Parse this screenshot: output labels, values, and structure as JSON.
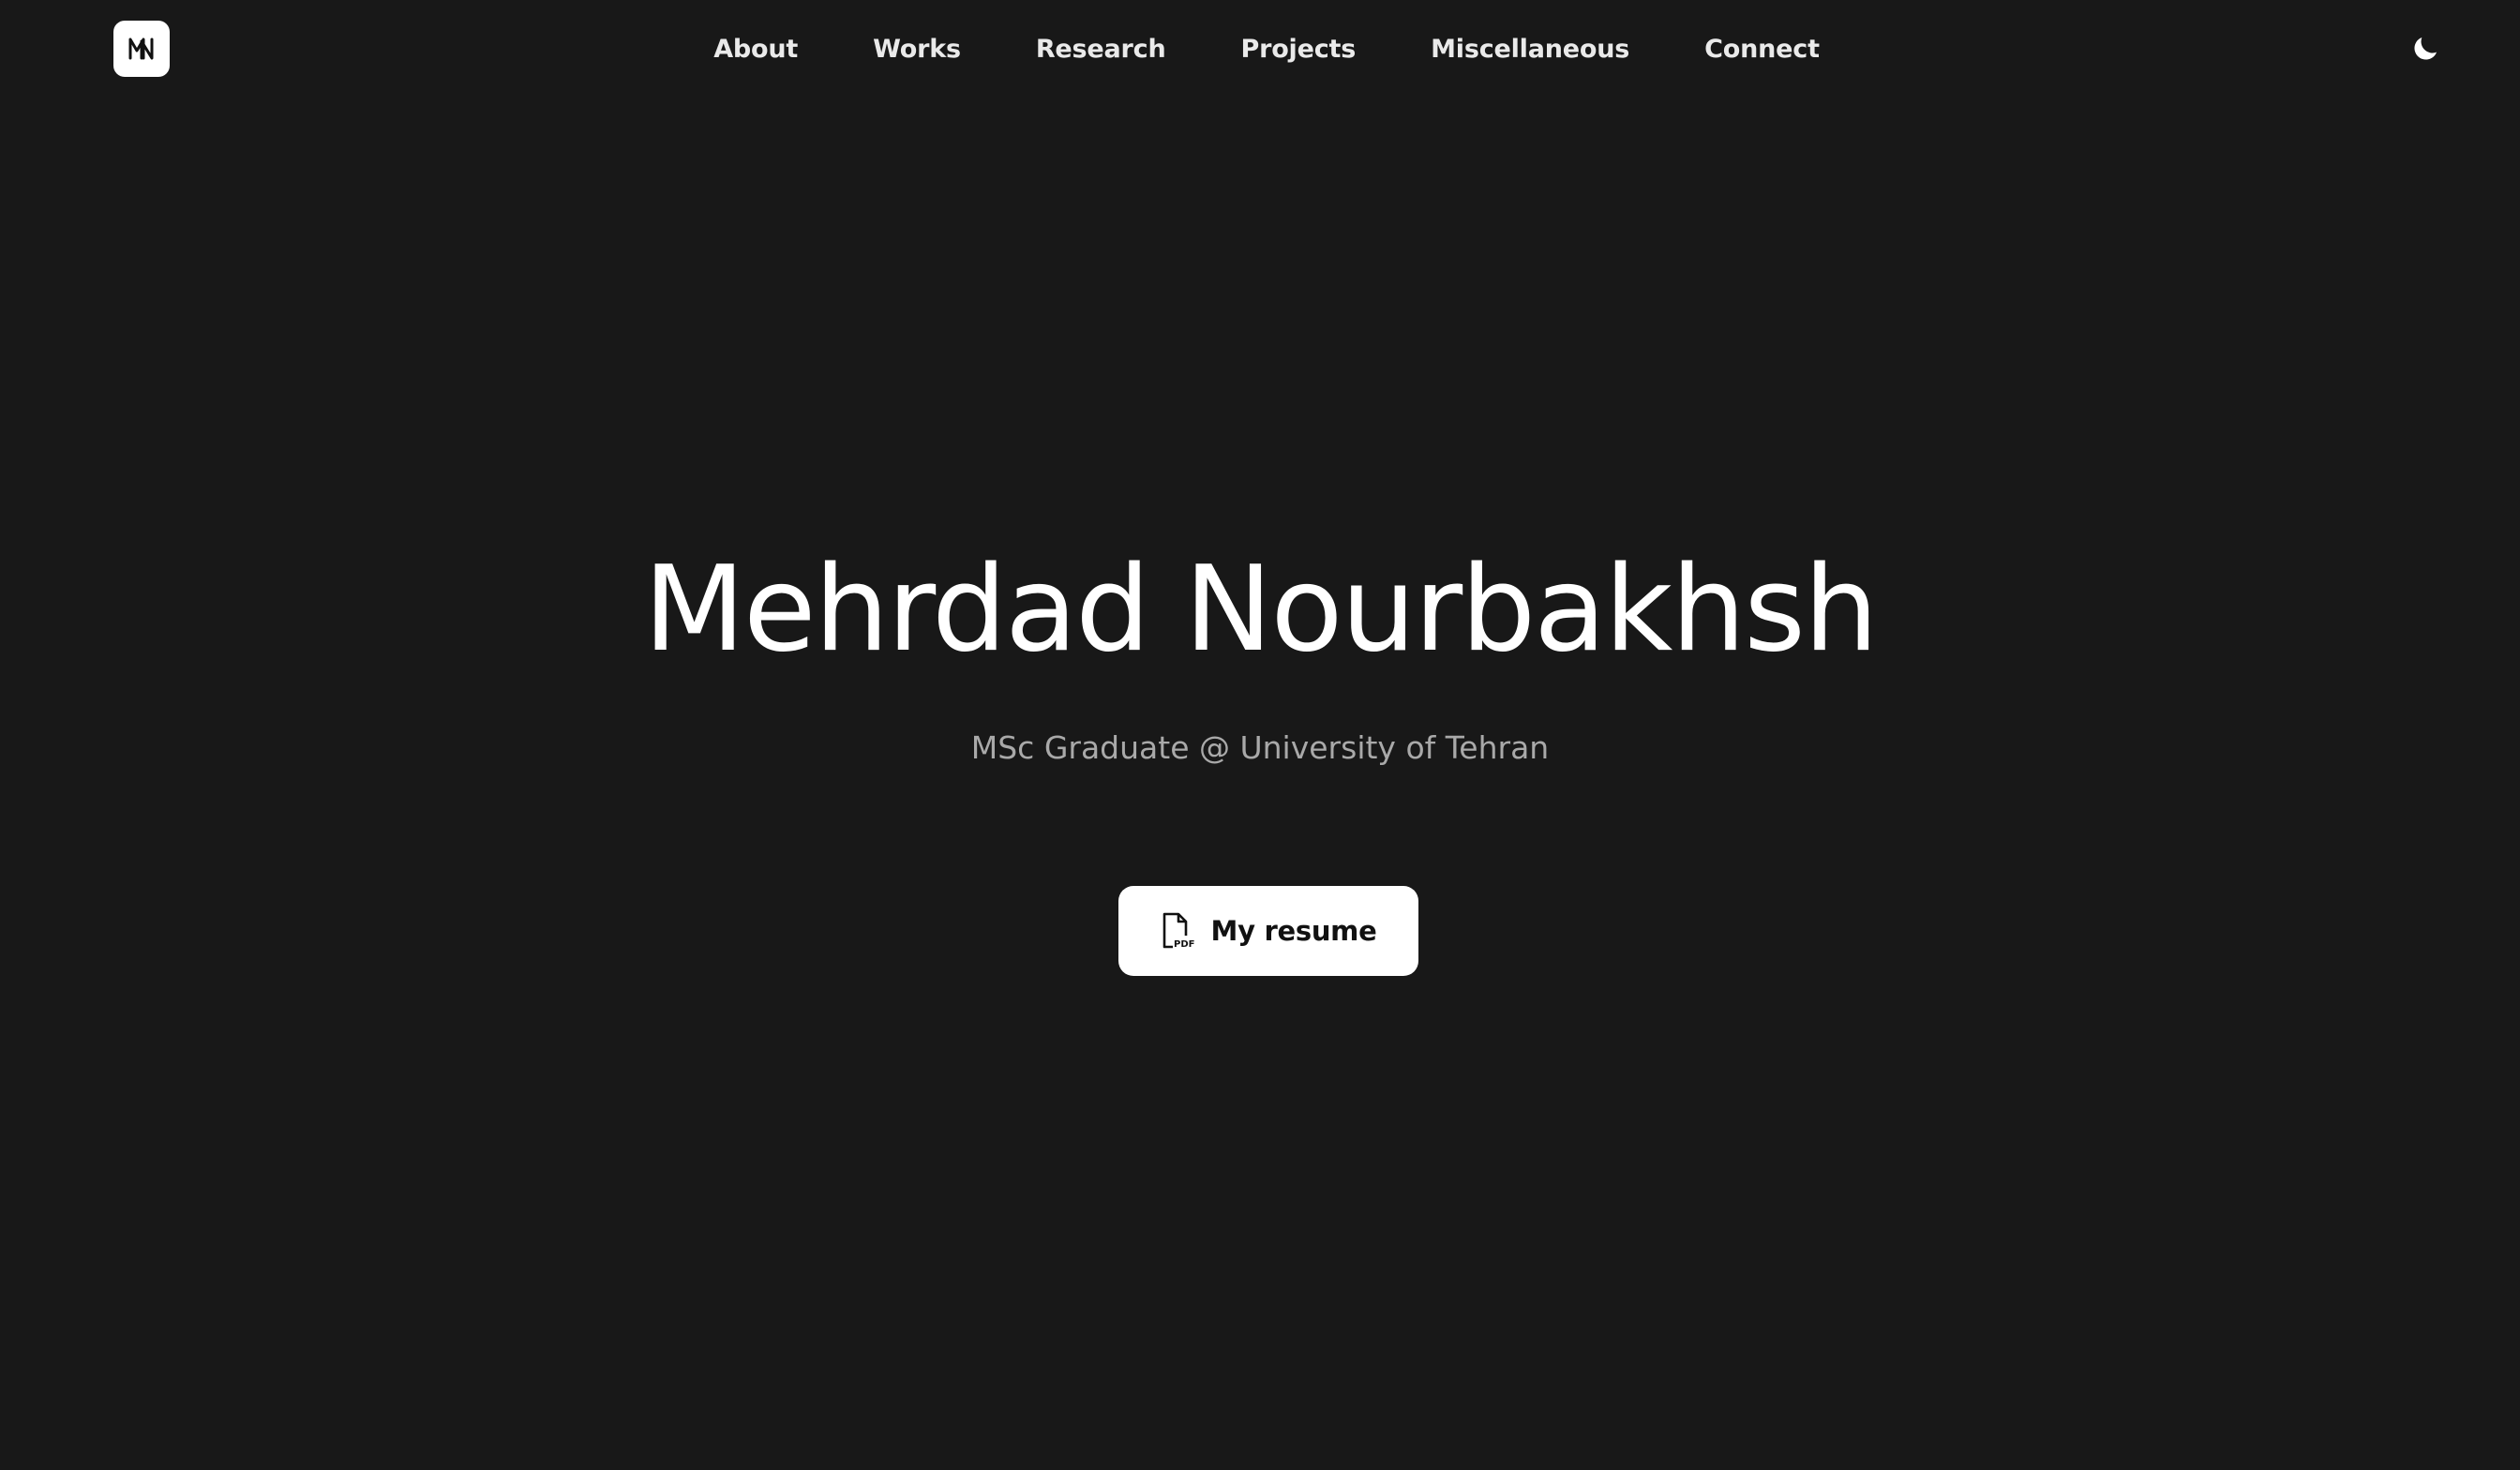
{
  "header": {
    "logo_icon": "mn-monogram-logo-icon",
    "nav_items": [
      {
        "label": "About"
      },
      {
        "label": "Works"
      },
      {
        "label": "Research"
      },
      {
        "label": "Projects"
      },
      {
        "label": "Miscellaneous"
      },
      {
        "label": "Connect"
      }
    ],
    "theme_toggle_icon": "moon-icon"
  },
  "hero": {
    "name": "Mehrdad Nourbakhsh",
    "subtitle": "MSc Graduate @ University of Tehran",
    "resume_button": {
      "label": "My resume",
      "icon": "pdf-file-icon"
    }
  },
  "colors": {
    "background": "#181818",
    "text_primary": "#ffffff",
    "text_muted": "#a9a9a9",
    "button_bg": "#ffffff",
    "button_text": "#111111"
  }
}
